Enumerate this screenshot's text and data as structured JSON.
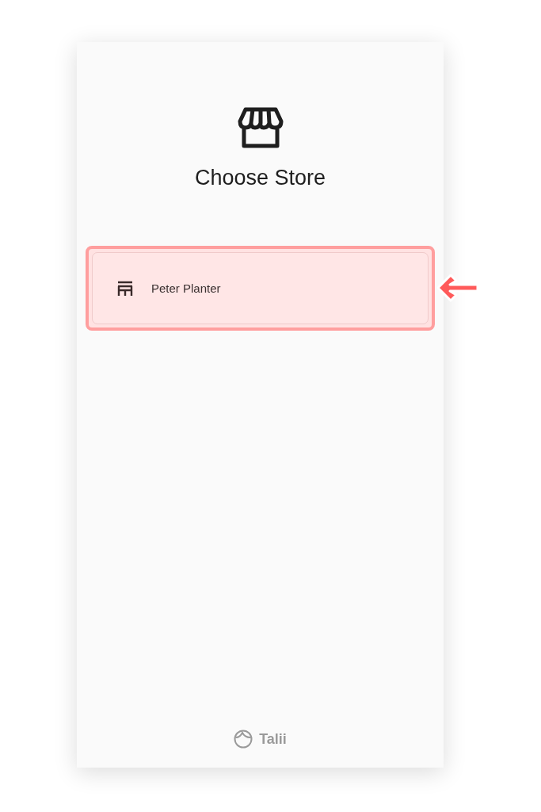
{
  "header": {
    "title": "Choose Store"
  },
  "stores": [
    {
      "name": "Peter Planter",
      "selected": true
    }
  ],
  "footer": {
    "brand": "Talii"
  }
}
